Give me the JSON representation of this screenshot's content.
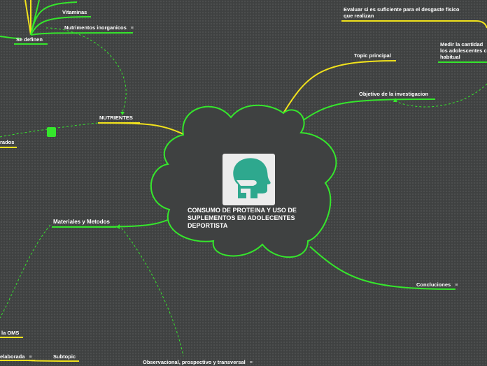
{
  "central": {
    "title": "CONSUMO DE PROTEINA Y USO DE SUPLEMENTOS EN ADOLECENTES DEPORTISTA",
    "icon": "head-profile-icon"
  },
  "nodes": {
    "vitaminas": "Vitaminas",
    "nutrimentos_inorganicos": "Nutrimentos inorganicos",
    "se_definen": "Se definen",
    "nutrientes": "NUTRIENTES",
    "rados": "rados",
    "materiales": "Materiales y Metodos",
    "oms": "la OMS",
    "elaborada": "elaborada",
    "subtopic": "Subtopic",
    "observacional": "Observacional, prospectivo y transversal",
    "evaluar": "Evaluar si es suficiente para el desgaste fisico que realizan",
    "topic_principal": "Topic principal",
    "medir": "Medir la cantidad los adolescentes c habitual",
    "objetivo": "Objetivo de la investigacion",
    "conclusiones": "Concluciones"
  },
  "menu_glyph": "≡",
  "colors": {
    "background": "#3f4141",
    "green": "#35e62c",
    "yellow": "#f1e21c",
    "text": "#ffffff"
  }
}
